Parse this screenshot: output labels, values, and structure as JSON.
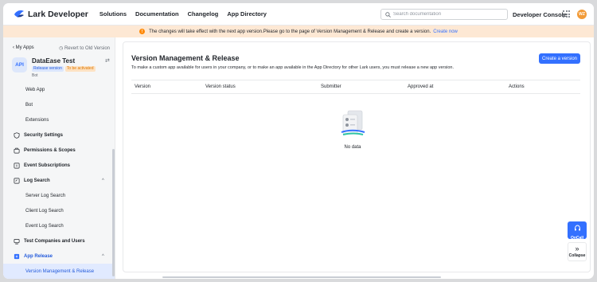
{
  "nav": {
    "logo": "Lark Developer",
    "links": [
      "Solutions",
      "Documentation",
      "Changelog",
      "App Directory"
    ],
    "search_placeholder": "Search documentation",
    "console": "Developer Console",
    "avatar": "WZ"
  },
  "banner": {
    "text": "The changes will take effect with the next app version.Please go to the page of Version Management & Release and create a version.",
    "link": "Create now"
  },
  "sidebar": {
    "back": "My Apps",
    "revert": "Revert to Old Version",
    "app": {
      "icon": "API",
      "name": "DataEase Test",
      "badge_version": "Release version",
      "badge_status": "To be activated",
      "type": "Bot"
    },
    "items": [
      {
        "label": "Web App",
        "kind": "sub"
      },
      {
        "label": "Bot",
        "kind": "sub"
      },
      {
        "label": "Extensions",
        "kind": "sub"
      },
      {
        "label": "Security Settings",
        "kind": "top",
        "icon": "shield-icon"
      },
      {
        "label": "Permissions & Scopes",
        "kind": "top",
        "icon": "briefcase-icon"
      },
      {
        "label": "Event Subscriptions",
        "kind": "top",
        "icon": "event-icon"
      },
      {
        "label": "Log Search",
        "kind": "top",
        "icon": "log-icon",
        "chevron": "^"
      },
      {
        "label": "Server Log Search",
        "kind": "sub"
      },
      {
        "label": "Client Log Search",
        "kind": "sub"
      },
      {
        "label": "Event Log Search",
        "kind": "sub"
      },
      {
        "label": "Test Companies and Users",
        "kind": "top",
        "icon": "users-icon"
      },
      {
        "label": "App Release",
        "kind": "top",
        "icon": "release-icon",
        "chevron": "^"
      },
      {
        "label": "Version Management & Release",
        "kind": "sub",
        "active": true
      }
    ]
  },
  "main": {
    "title": "Version Management & Release",
    "description": "To make a custom app available for users in your company, or to make an app available in the App Directory for other Lark users, you must release a new app version.",
    "create_button": "Create a version",
    "columns": [
      "Version",
      "Version status",
      "Submitter",
      "Approved at",
      "Actions"
    ],
    "empty_text": "No data"
  },
  "float": {
    "oncall": "OnCall",
    "collapse": "Collapse"
  },
  "colors": {
    "accent": "#3370ff",
    "banner_bg": "#fde8d4",
    "warning": "#ff8800"
  }
}
